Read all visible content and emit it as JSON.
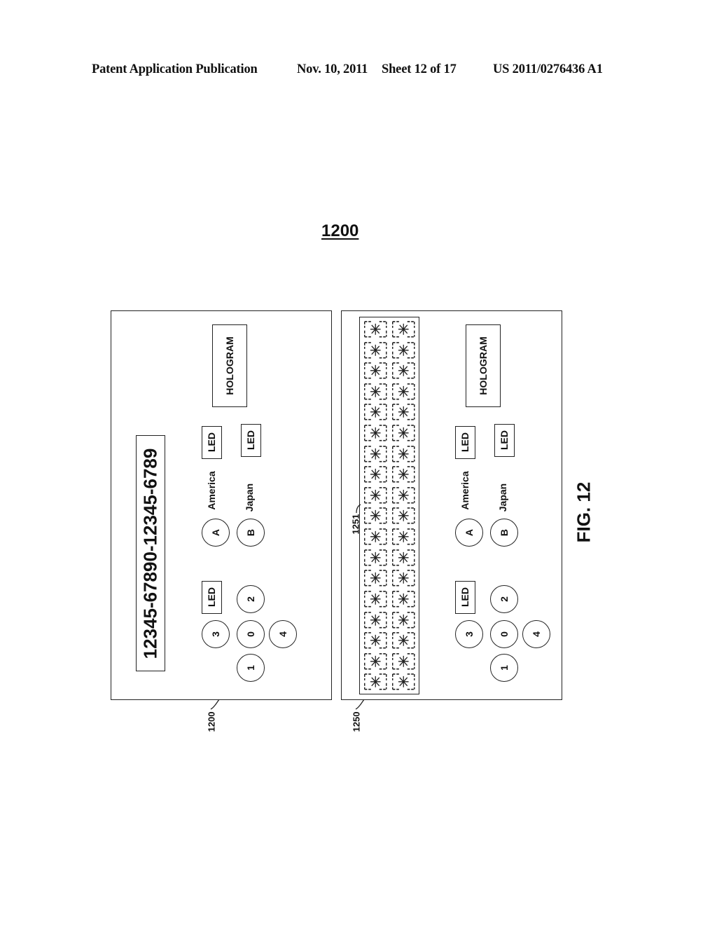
{
  "header": {
    "publication": "Patent Application Publication",
    "date": "Nov. 10, 2011",
    "sheet": "Sheet 12 of 17",
    "number": "US 2011/0276436 A1"
  },
  "figure": {
    "reference": "1200",
    "caption": "FIG. 12"
  },
  "panels": [
    {
      "id": "1200",
      "ref_label": "1200",
      "display_text": "12345-67890-12345-6789",
      "hologram_label": "HOLOGRAM",
      "region_buttons": [
        {
          "label": "A",
          "caption": "America",
          "indicator": "LED"
        },
        {
          "label": "B",
          "caption": "Japan",
          "indicator": "LED"
        }
      ],
      "keypad": {
        "indicator": "LED",
        "keys": [
          "3",
          "0",
          "2",
          "1",
          "4"
        ]
      }
    },
    {
      "id": "1250",
      "ref_label": "1250",
      "matrix_ref_label": "1251",
      "matrix": {
        "columns": 2,
        "rows": 18
      },
      "hologram_label": "HOLOGRAM",
      "region_buttons": [
        {
          "label": "A",
          "caption": "America",
          "indicator": "LED"
        },
        {
          "label": "B",
          "caption": "Japan",
          "indicator": "LED"
        }
      ],
      "keypad": {
        "indicator": "LED",
        "keys": [
          "3",
          "0",
          "2",
          "1",
          "4"
        ]
      }
    }
  ]
}
